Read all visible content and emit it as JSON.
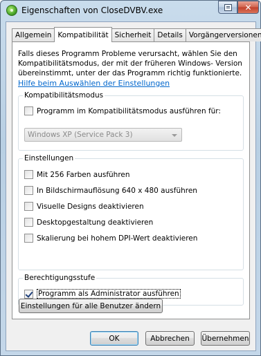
{
  "window": {
    "title": "Eigenschaften von CloseDVBV.exe"
  },
  "tabs": [
    {
      "label": "Allgemein"
    },
    {
      "label": "Kompatibilität"
    },
    {
      "label": "Sicherheit"
    },
    {
      "label": "Details"
    },
    {
      "label": "Vorgängerversionen"
    }
  ],
  "active_tab": "Kompatibilität",
  "intro_text": "Falls dieses Programm Probleme verursacht, wählen Sie den Kompatibilitätsmodus, der mit der früheren Windows- Version übereinstimmt, unter der das Programm richtig funktionierte.",
  "help_link": "Hilfe beim Auswählen der Einstellungen",
  "compat_mode": {
    "title": "Kompatibilitätsmodus",
    "checkbox_label": "Programm im Kompatibilitätsmodus ausführen für:",
    "checked": false,
    "select_value": "Windows XP (Service Pack 3)"
  },
  "settings": {
    "title": "Einstellungen",
    "items": [
      {
        "label": "Mit 256 Farben ausführen",
        "checked": false
      },
      {
        "label": "In Bildschirmauflösung 640 x 480 ausführen",
        "checked": false
      },
      {
        "label": "Visuelle Designs deaktivieren",
        "checked": false
      },
      {
        "label": "Desktopgestaltung deaktivieren",
        "checked": false
      },
      {
        "label": "Skalierung bei hohem DPI-Wert deaktivieren",
        "checked": false
      }
    ]
  },
  "privilege": {
    "title": "Berechtigungsstufe",
    "checkbox_label": "Programm als Administrator ausführen",
    "checked": true
  },
  "all_users_button": "Einstellungen für alle Benutzer ändern",
  "footer": {
    "ok": "OK",
    "cancel": "Abbrechen",
    "apply": "Übernehmen"
  },
  "colors": {
    "link": "#0066cc",
    "close_button": "#c1402a",
    "default_button_border": "#3c7fb1"
  }
}
